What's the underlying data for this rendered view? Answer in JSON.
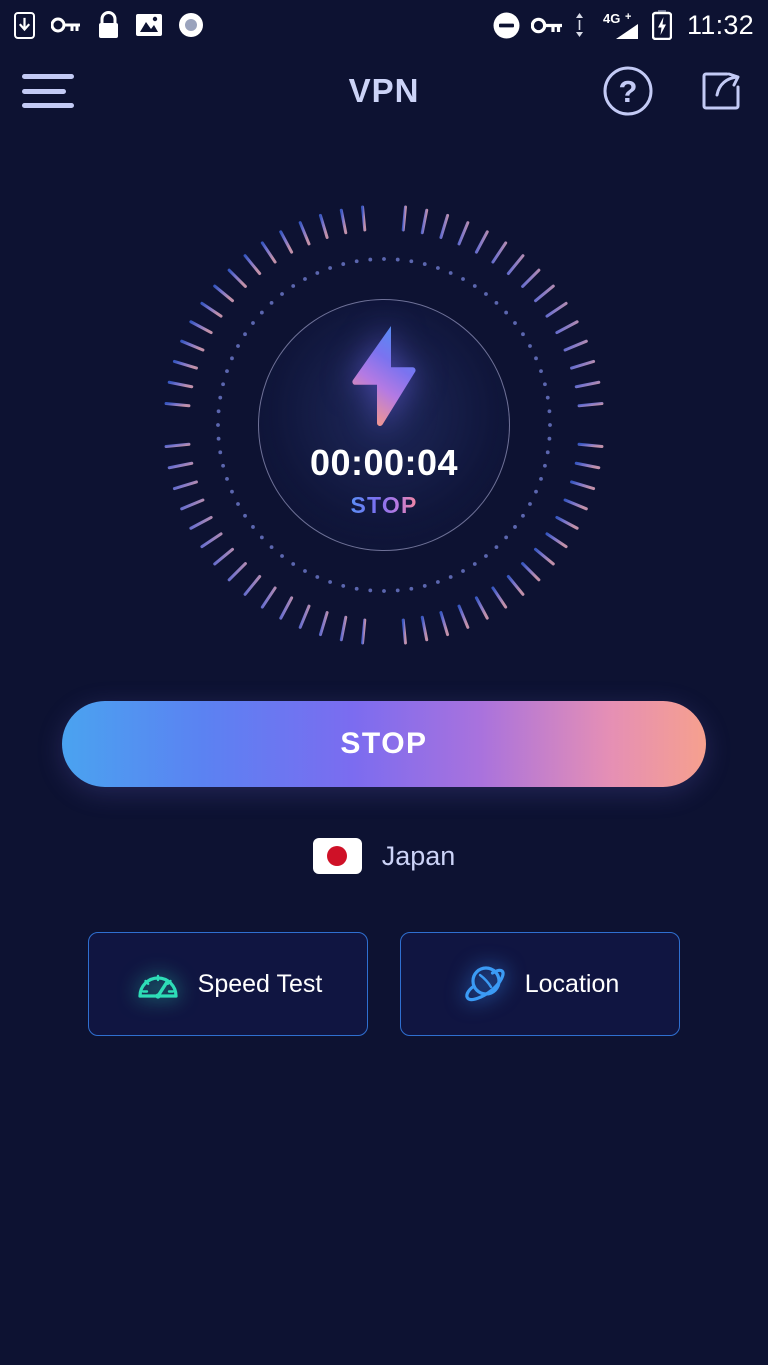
{
  "status_bar": {
    "left_icons": [
      {
        "name": "download-to-phone-icon",
        "label": "download"
      },
      {
        "name": "vpn-key-icon",
        "label": "vpn key"
      },
      {
        "name": "lock-icon",
        "label": "lock"
      },
      {
        "name": "image-icon",
        "label": "screenshot"
      },
      {
        "name": "record-icon",
        "label": "record"
      }
    ],
    "right_icons": [
      {
        "name": "do-not-disturb-icon",
        "label": "do not disturb"
      },
      {
        "name": "vpn-key-icon",
        "label": "vpn active"
      },
      {
        "name": "data-transfer-icon",
        "label": "data transfer"
      },
      {
        "name": "signal-4g-plus-icon",
        "label": "4G+"
      },
      {
        "name": "battery-charging-icon",
        "label": "battery charging"
      }
    ],
    "network_label": "4G+",
    "time": "11:32"
  },
  "app_bar": {
    "menu_icon": "hamburger-menu-icon",
    "title": "VPN",
    "help_icon": "help-circle-icon",
    "share_icon": "share-icon"
  },
  "dial": {
    "timer": "00:00:04",
    "status_label": "STOP",
    "bolt_icon": "lightning-bolt-icon"
  },
  "main_button": {
    "label": "STOP"
  },
  "country": {
    "flag_icon": "japan-flag-icon",
    "name": "Japan"
  },
  "actions": [
    {
      "icon": "speedometer-icon",
      "label": "Speed Test"
    },
    {
      "icon": "planet-globe-icon",
      "label": "Location"
    }
  ],
  "colors": {
    "background": "#0d1232",
    "accent_blue": "#4aa3f0",
    "accent_purple": "#7b6cf0",
    "accent_pink": "#f4879c",
    "text_light": "#ccd3f7",
    "teal": "#2eddb7",
    "border_blue": "#2f6fd0"
  }
}
